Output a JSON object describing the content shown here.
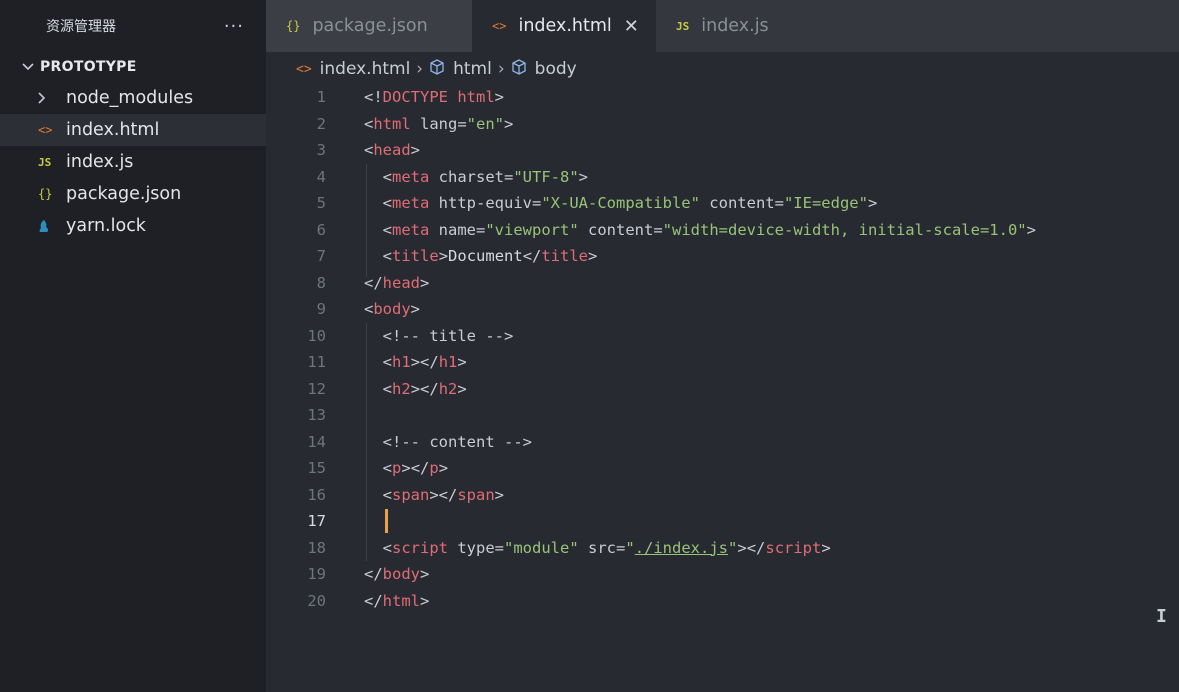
{
  "explorer": {
    "title": "资源管理器",
    "more": "···",
    "section": "PROTOTYPE",
    "items": [
      {
        "name": "node_modules",
        "icon": "folder-chevron-icon"
      },
      {
        "name": "index.html",
        "icon": "html-icon"
      },
      {
        "name": "index.js",
        "icon": "js-icon"
      },
      {
        "name": "package.json",
        "icon": "json-icon"
      },
      {
        "name": "yarn.lock",
        "icon": "yarn-icon"
      }
    ]
  },
  "tabs": [
    {
      "label": "package.json",
      "icon": "{}"
    },
    {
      "label": "index.html",
      "icon": "<>",
      "close": "✕"
    },
    {
      "label": "index.js",
      "icon": "JS"
    }
  ],
  "breadcrumb": [
    "index.html",
    "html",
    "body"
  ],
  "line_numbers": [
    "1",
    "2",
    "3",
    "4",
    "5",
    "6",
    "7",
    "8",
    "9",
    "10",
    "11",
    "12",
    "13",
    "14",
    "15",
    "16",
    "17",
    "18",
    "19",
    "20"
  ],
  "current_line": "17",
  "code": {
    "l1": {
      "open": "<!",
      "tag": "DOCTYPE",
      "rest": " html",
      "close": ">"
    },
    "l2": {
      "open": "<",
      "tag": "html",
      "attr": " lang=",
      "str": "\"en\"",
      "close": ">"
    },
    "l3": {
      "open": "<",
      "tag": "head",
      "close": ">"
    },
    "l4": {
      "open": "<",
      "tag": "meta",
      "attr": " charset=",
      "str": "\"UTF-8\"",
      "close": ">"
    },
    "l5": {
      "open": "<",
      "tag": "meta",
      "attr1": " http-equiv=",
      "str1": "\"X-UA-Compatible\"",
      "attr2": " content=",
      "str2": "\"IE=edge\"",
      "close": ">"
    },
    "l6": {
      "open": "<",
      "tag": "meta",
      "attr1": " name=",
      "str1": "\"viewport\"",
      "attr2": " content=",
      "str2": "\"width=device-width, initial-scale=1.0\"",
      "close": ">"
    },
    "l7": {
      "open": "<",
      "tag": "title",
      "mid": ">",
      "text": "Document",
      "open2": "</",
      "tag2": "title",
      "close": ">"
    },
    "l8": {
      "open": "</",
      "tag": "head",
      "close": ">"
    },
    "l9": {
      "open": "<",
      "tag": "body",
      "close": ">"
    },
    "l10": {
      "comment": "<!-- title -->"
    },
    "l11": {
      "open": "<",
      "tag": "h1",
      "mid": "></",
      "tag2": "h1",
      "close": ">"
    },
    "l12": {
      "open": "<",
      "tag": "h2",
      "mid": "></",
      "tag2": "h2",
      "close": ">"
    },
    "l14": {
      "comment": "<!-- content -->"
    },
    "l15": {
      "open": "<",
      "tag": "p",
      "mid": "></",
      "tag2": "p",
      "close": ">"
    },
    "l16": {
      "open": "<",
      "tag": "span",
      "mid": "></",
      "tag2": "span",
      "close": ">"
    },
    "l18": {
      "open": "<",
      "tag": "script",
      "attr1": " type=",
      "str1": "\"module\"",
      "attr2": " src=",
      "q1": "\"",
      "link": "./index.js",
      "q2": "\"",
      "mid": "></",
      "tag2": "script",
      "close": ">"
    },
    "l19": {
      "open": "</",
      "tag": "body",
      "close": ">"
    },
    "l20": {
      "open": "</",
      "tag": "html",
      "close": ">"
    }
  },
  "colors": {
    "tag": "#e06c75",
    "string": "#98c379",
    "cursor": "#e8a24c",
    "html_icon": "#e37933",
    "js_icon": "#cbcb41"
  }
}
